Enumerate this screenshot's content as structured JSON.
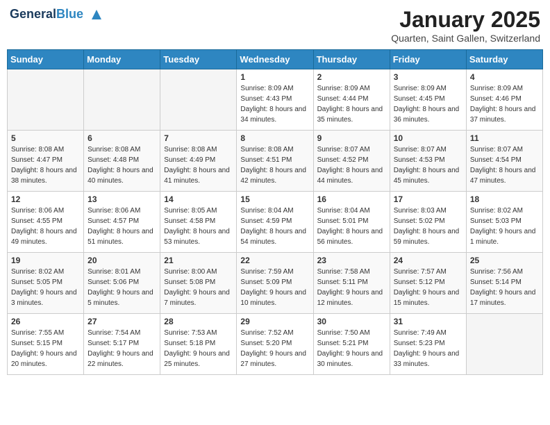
{
  "header": {
    "logo_line1": "General",
    "logo_line2": "Blue",
    "month_title": "January 2025",
    "location": "Quarten, Saint Gallen, Switzerland"
  },
  "days_of_week": [
    "Sunday",
    "Monday",
    "Tuesday",
    "Wednesday",
    "Thursday",
    "Friday",
    "Saturday"
  ],
  "weeks": [
    [
      {
        "day": "",
        "empty": true
      },
      {
        "day": "",
        "empty": true
      },
      {
        "day": "",
        "empty": true
      },
      {
        "day": "1",
        "sunrise": "8:09 AM",
        "sunset": "4:43 PM",
        "daylight": "8 hours and 34 minutes."
      },
      {
        "day": "2",
        "sunrise": "8:09 AM",
        "sunset": "4:44 PM",
        "daylight": "8 hours and 35 minutes."
      },
      {
        "day": "3",
        "sunrise": "8:09 AM",
        "sunset": "4:45 PM",
        "daylight": "8 hours and 36 minutes."
      },
      {
        "day": "4",
        "sunrise": "8:09 AM",
        "sunset": "4:46 PM",
        "daylight": "8 hours and 37 minutes."
      }
    ],
    [
      {
        "day": "5",
        "sunrise": "8:08 AM",
        "sunset": "4:47 PM",
        "daylight": "8 hours and 38 minutes."
      },
      {
        "day": "6",
        "sunrise": "8:08 AM",
        "sunset": "4:48 PM",
        "daylight": "8 hours and 40 minutes."
      },
      {
        "day": "7",
        "sunrise": "8:08 AM",
        "sunset": "4:49 PM",
        "daylight": "8 hours and 41 minutes."
      },
      {
        "day": "8",
        "sunrise": "8:08 AM",
        "sunset": "4:51 PM",
        "daylight": "8 hours and 42 minutes."
      },
      {
        "day": "9",
        "sunrise": "8:07 AM",
        "sunset": "4:52 PM",
        "daylight": "8 hours and 44 minutes."
      },
      {
        "day": "10",
        "sunrise": "8:07 AM",
        "sunset": "4:53 PM",
        "daylight": "8 hours and 45 minutes."
      },
      {
        "day": "11",
        "sunrise": "8:07 AM",
        "sunset": "4:54 PM",
        "daylight": "8 hours and 47 minutes."
      }
    ],
    [
      {
        "day": "12",
        "sunrise": "8:06 AM",
        "sunset": "4:55 PM",
        "daylight": "8 hours and 49 minutes."
      },
      {
        "day": "13",
        "sunrise": "8:06 AM",
        "sunset": "4:57 PM",
        "daylight": "8 hours and 51 minutes."
      },
      {
        "day": "14",
        "sunrise": "8:05 AM",
        "sunset": "4:58 PM",
        "daylight": "8 hours and 53 minutes."
      },
      {
        "day": "15",
        "sunrise": "8:04 AM",
        "sunset": "4:59 PM",
        "daylight": "8 hours and 54 minutes."
      },
      {
        "day": "16",
        "sunrise": "8:04 AM",
        "sunset": "5:01 PM",
        "daylight": "8 hours and 56 minutes."
      },
      {
        "day": "17",
        "sunrise": "8:03 AM",
        "sunset": "5:02 PM",
        "daylight": "8 hours and 59 minutes."
      },
      {
        "day": "18",
        "sunrise": "8:02 AM",
        "sunset": "5:03 PM",
        "daylight": "9 hours and 1 minute."
      }
    ],
    [
      {
        "day": "19",
        "sunrise": "8:02 AM",
        "sunset": "5:05 PM",
        "daylight": "9 hours and 3 minutes."
      },
      {
        "day": "20",
        "sunrise": "8:01 AM",
        "sunset": "5:06 PM",
        "daylight": "9 hours and 5 minutes."
      },
      {
        "day": "21",
        "sunrise": "8:00 AM",
        "sunset": "5:08 PM",
        "daylight": "9 hours and 7 minutes."
      },
      {
        "day": "22",
        "sunrise": "7:59 AM",
        "sunset": "5:09 PM",
        "daylight": "9 hours and 10 minutes."
      },
      {
        "day": "23",
        "sunrise": "7:58 AM",
        "sunset": "5:11 PM",
        "daylight": "9 hours and 12 minutes."
      },
      {
        "day": "24",
        "sunrise": "7:57 AM",
        "sunset": "5:12 PM",
        "daylight": "9 hours and 15 minutes."
      },
      {
        "day": "25",
        "sunrise": "7:56 AM",
        "sunset": "5:14 PM",
        "daylight": "9 hours and 17 minutes."
      }
    ],
    [
      {
        "day": "26",
        "sunrise": "7:55 AM",
        "sunset": "5:15 PM",
        "daylight": "9 hours and 20 minutes."
      },
      {
        "day": "27",
        "sunrise": "7:54 AM",
        "sunset": "5:17 PM",
        "daylight": "9 hours and 22 minutes."
      },
      {
        "day": "28",
        "sunrise": "7:53 AM",
        "sunset": "5:18 PM",
        "daylight": "9 hours and 25 minutes."
      },
      {
        "day": "29",
        "sunrise": "7:52 AM",
        "sunset": "5:20 PM",
        "daylight": "9 hours and 27 minutes."
      },
      {
        "day": "30",
        "sunrise": "7:50 AM",
        "sunset": "5:21 PM",
        "daylight": "9 hours and 30 minutes."
      },
      {
        "day": "31",
        "sunrise": "7:49 AM",
        "sunset": "5:23 PM",
        "daylight": "9 hours and 33 minutes."
      },
      {
        "day": "",
        "empty": true
      }
    ]
  ]
}
